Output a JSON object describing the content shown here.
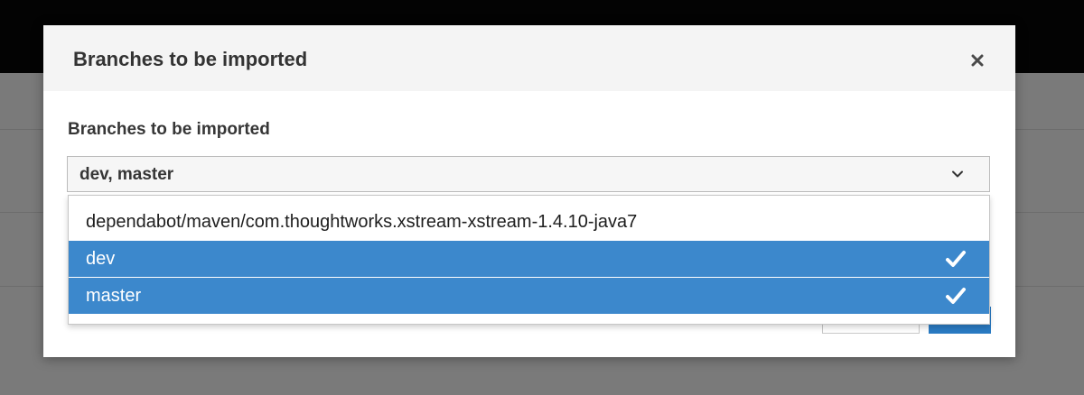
{
  "modal": {
    "title": "Branches to be imported",
    "close_icon": "close-icon"
  },
  "field": {
    "label": "Branches to be imported",
    "value": "dev, master",
    "icon": "chevron-down-icon"
  },
  "dropdown": {
    "options": [
      {
        "label": "dependabot/maven/com.thoughtworks.xstream-xstream-1.4.10-java7",
        "selected": false
      },
      {
        "label": "dev",
        "selected": true
      },
      {
        "label": "master",
        "selected": true
      }
    ],
    "check_icon": "checkmark-icon"
  },
  "colors": {
    "selected_bg": "#3c88cc",
    "primary_button": "#2a7bc3",
    "overlay": "#7a7a7a",
    "topbar": "#030303"
  }
}
